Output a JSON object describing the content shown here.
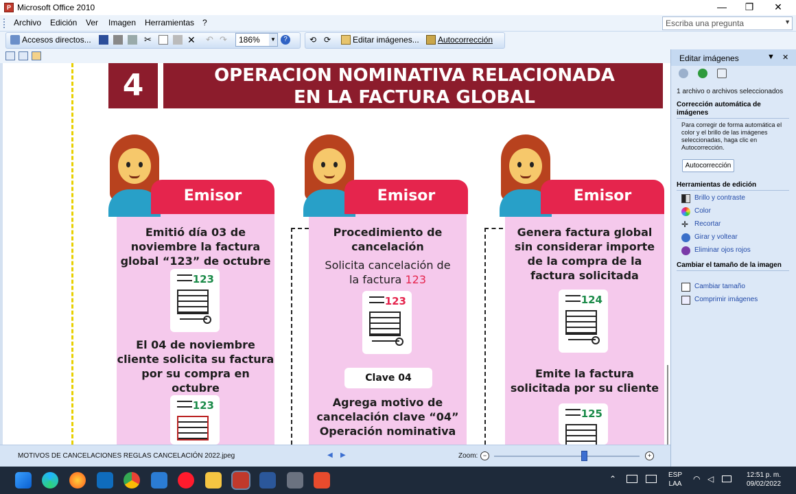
{
  "window": {
    "title": "Microsoft Office 2010",
    "minimize": "—",
    "maximize": "❐",
    "close": "✕"
  },
  "menu": {
    "items": [
      "Archivo",
      "Edición",
      "Ver",
      "Imagen",
      "Herramientas",
      "?"
    ],
    "ask_placeholder": "Escriba una pregunta"
  },
  "toolbar": {
    "accesos": "Accesos directos...",
    "zoom": "186%",
    "editar": "Editar imágenes...",
    "autocorreccion": "Autocorrección"
  },
  "image": {
    "header_number": "4",
    "header_line1": "OPERACION NOMINATIVA RELACIONADA",
    "header_line2": "EN LA FACTURA GLOBAL",
    "columns": [
      {
        "tab": "Emisor",
        "text1_a": "Emitió día 03 de",
        "text1_b": "noviembre la",
        "text1_b_bold": "factura",
        "text1_c_bold": "global",
        "text1_c_quote": "“123”",
        "text1_c": "de octubre",
        "invoice1": "123",
        "text2_a": "El 04 de noviembre",
        "text2_b": "cliente solicita su",
        "text2_b_bold": "factura",
        "text2_c": "por su compra en",
        "text2_d": "octubre",
        "invoice2": "123"
      },
      {
        "tab": "Emisor",
        "text1_a": "Procedimiento de",
        "text1_b": "cancelación",
        "text2_a": "Solicita cancelación de",
        "text2_b": "la factura",
        "text2_b_red": "123",
        "invoice1": "123",
        "clave": "Clave 04",
        "text3_a": "Agrega motivo de",
        "text3_b": "cancelación",
        "text3_b_bold": "clave “04”",
        "text3_c": "Operación nominativa"
      },
      {
        "tab": "Emisor",
        "text1_a": "Genera factura global",
        "text1_b": "sin considerar importe",
        "text1_c": "de la compra de la",
        "text1_d": "factura solicitada",
        "invoice1": "124",
        "text2_a": "Emite la factura",
        "text2_b": "solicitada por su cliente",
        "invoice2": "125"
      }
    ]
  },
  "status": {
    "filename": "MOTIVOS DE CANCELACIONES REGLAS CANCELACIÓN 2022.jpeg",
    "zoom_label": "Zoom:",
    "zoom_level": 0.62
  },
  "taskpane": {
    "title": "Editar imágenes",
    "selected": "1 archivo o archivos seleccionados",
    "sec1": "Corrección automática de imágenes",
    "sec1_text": "Para corregir de forma automática el color y el brillo de las imágenes seleccionadas, haga clic en Autocorrección.",
    "autocorr_btn": "Autocorrección",
    "sec2": "Herramientas de edición",
    "tools": [
      "Brillo y contraste",
      "Color",
      "Recortar",
      "Girar y voltear",
      "Eliminar ojos rojos"
    ],
    "sec3": "Cambiar el tamaño de la imagen",
    "resize": [
      "Cambiar tamaño",
      "Comprimir imágenes"
    ]
  },
  "taskbar": {
    "lang1": "ESP",
    "lang2": "LAA",
    "time": "12:51 p. m.",
    "date": "09/02/2022"
  },
  "colors": {
    "header": "#8c1c2c",
    "tab": "#e5254d",
    "column_bg": "#f5c9ec",
    "pane": "#dce8f7"
  }
}
